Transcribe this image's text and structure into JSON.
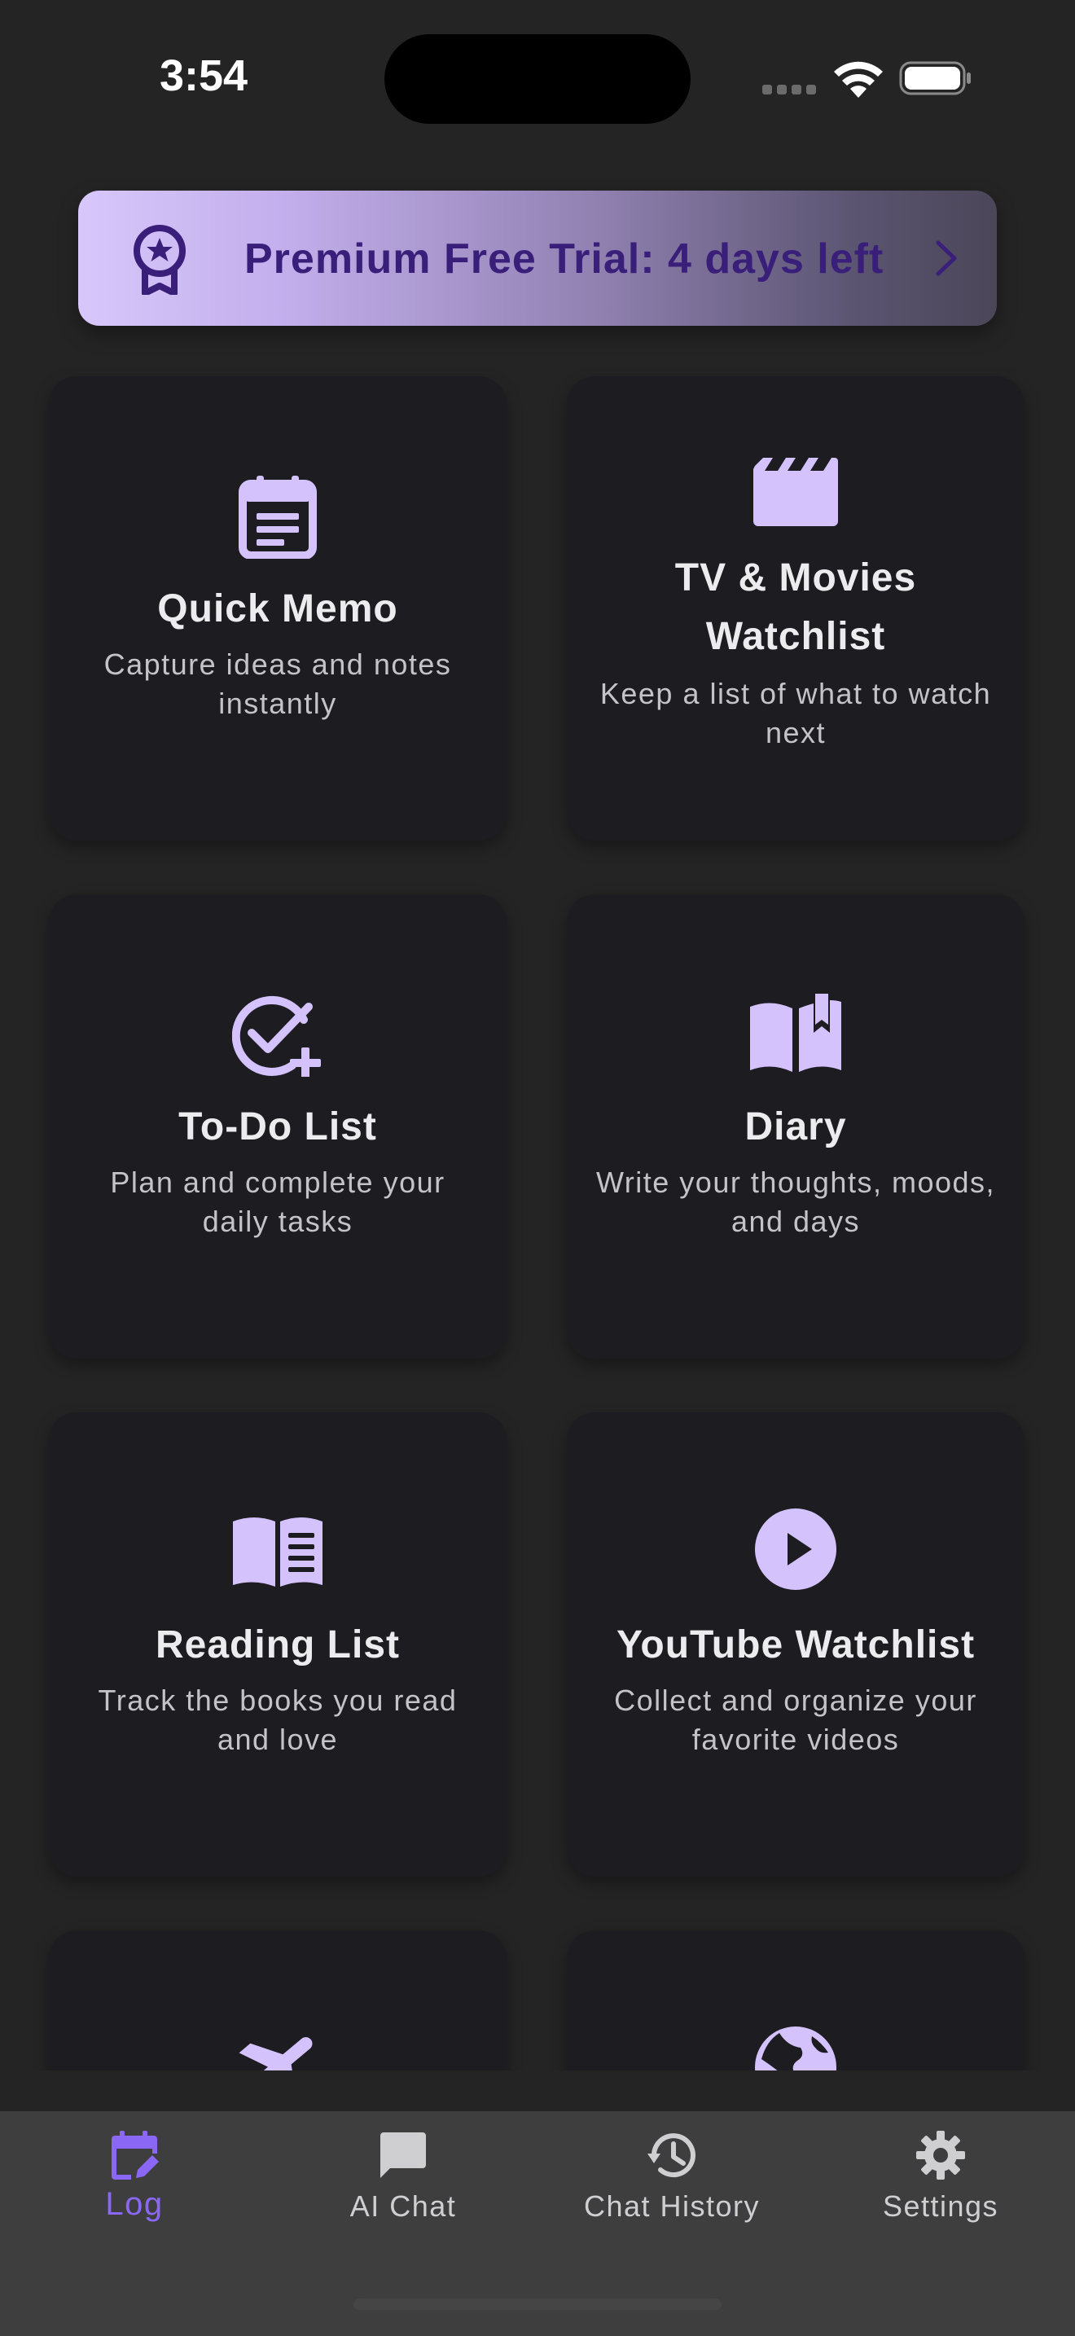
{
  "status_bar": {
    "time": "3:54"
  },
  "premium_banner": {
    "text": "Premium Free Trial: 4 days left",
    "icon": "award-badge-icon"
  },
  "cards": [
    {
      "title": "Quick Memo",
      "description": "Capture ideas and notes instantly",
      "icon": "calendar-note-icon"
    },
    {
      "title": "TV & Movies Watchlist",
      "description": "Keep a list of what to watch next",
      "icon": "clapperboard-icon"
    },
    {
      "title": "To-Do List",
      "description": "Plan and complete your daily tasks",
      "icon": "check-circle-plus-icon"
    },
    {
      "title": "Diary",
      "description": "Write your thoughts, moods, and days",
      "icon": "open-book-bookmark-icon"
    },
    {
      "title": "Reading List",
      "description": "Track the books you read and love",
      "icon": "book-lines-icon"
    },
    {
      "title": "YouTube Watchlist",
      "description": "Collect and organize your favorite videos",
      "icon": "play-circle-icon"
    },
    {
      "title": "",
      "description": "",
      "icon": "airplane-icon"
    },
    {
      "title": "",
      "description": "",
      "icon": "globe-icon"
    }
  ],
  "tabs": [
    {
      "label": "Log",
      "icon": "calendar-edit-icon",
      "active": true
    },
    {
      "label": "AI Chat",
      "icon": "chat-bubble-icon",
      "active": false
    },
    {
      "label": "Chat History",
      "icon": "history-icon",
      "active": false
    },
    {
      "label": "Settings",
      "icon": "gear-icon",
      "active": false
    }
  ],
  "colors": {
    "accent": "#d4c2fc",
    "active_tab": "#8a68f5",
    "banner_text": "#3a1f7a",
    "card_bg": "#1d1c21",
    "page_bg": "#242424"
  }
}
